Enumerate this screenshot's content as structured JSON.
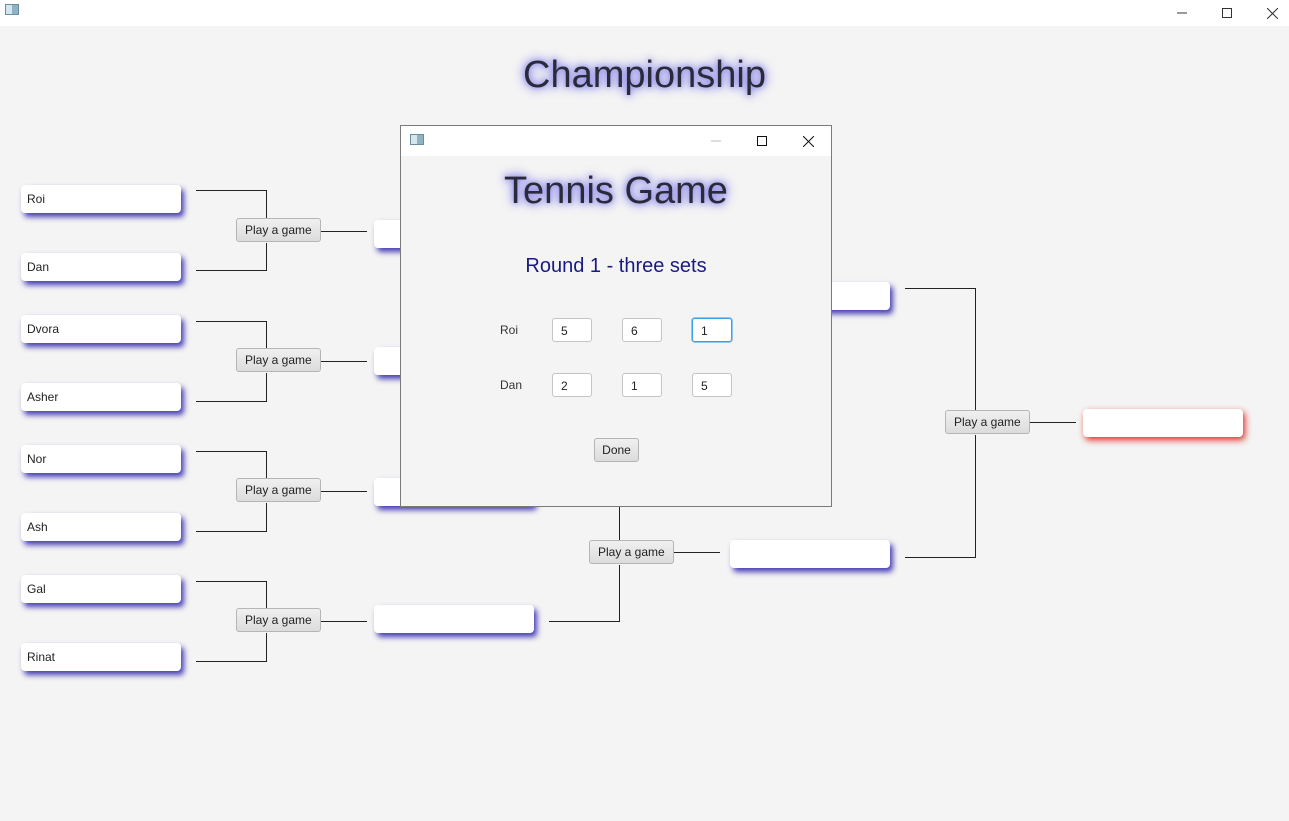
{
  "window": {
    "title": "",
    "controls": [
      "minimize-icon",
      "maximize-icon",
      "close-icon"
    ]
  },
  "main_title": "Championship",
  "bracket": {
    "players": [
      "Roi",
      "Dan",
      "Dvora",
      "Asher",
      "Nor",
      "Ash",
      "Gal",
      "Rinat"
    ],
    "play_button_label": "Play a game",
    "play_buttons": [
      "Play a game",
      "Play a game",
      "Play a game",
      "Play a game",
      "Play a game",
      "Play a game",
      "Play a game"
    ]
  },
  "dialog": {
    "title": "Tennis Game",
    "round_label": "Round 1 - three sets",
    "rows": [
      {
        "player": "Roi",
        "scores": [
          "5",
          "6",
          "1"
        ]
      },
      {
        "player": "Dan",
        "scores": [
          "2",
          "1",
          "5"
        ]
      }
    ],
    "done_label": "Done"
  },
  "colors": {
    "title_glow": "#8b87e6",
    "box_shadow": "#2a1eaa",
    "champion_glow": "#e61e1e",
    "round_label": "#1a1a80",
    "focus": "#3aa0e8"
  }
}
